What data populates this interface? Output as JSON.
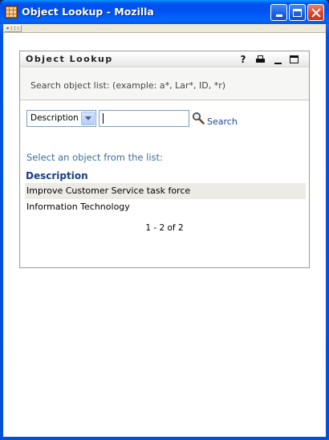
{
  "window": {
    "title": "Object Lookup - Mozilla"
  },
  "toolbar": {
    "grip_label": "▸:::"
  },
  "portlet": {
    "title": "Object Lookup",
    "help_glyph": "?",
    "instructions": "Search object list: (example: a*, Lar*, ID, *r)"
  },
  "search": {
    "attribute_selected": "Description",
    "query_value": "",
    "button_label": "Search"
  },
  "results": {
    "prompt": "Select an object from the list:",
    "column_header": "Description",
    "rows": [
      {
        "label": "Improve Customer Service task force"
      },
      {
        "label": "Information Technology"
      }
    ],
    "pager": "1 - 2 of 2"
  },
  "colors": {
    "titlebar": "#0053ee",
    "link": "#1b4598",
    "header_text": "#1a3f80",
    "prompt_text": "#3b6e9c",
    "row_highlight": "#ecebe6"
  }
}
